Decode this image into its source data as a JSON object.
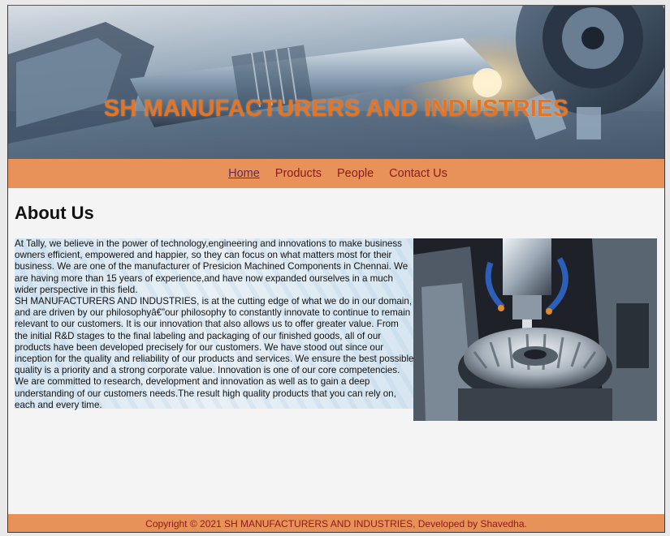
{
  "header": {
    "title": "SH MANUFACTURERS AND INDUSTRIES"
  },
  "nav": {
    "items": [
      {
        "label": "Home",
        "active": true
      },
      {
        "label": "Products",
        "active": false
      },
      {
        "label": "People",
        "active": false
      },
      {
        "label": "Contact Us",
        "active": false
      }
    ]
  },
  "about": {
    "heading": "About Us",
    "paragraph1": "At Tally, we believe in the power of technology,engineering and innovations to make business owners efficient, empowered and happier, so they can focus on what matters most for their business. We are one of the manufacturer of Presicion Machined Components in Chennai. We are having more than 15 years of experience,and have now expanded ourselves in a much wider perspective in this field.",
    "paragraph2": "SH MANUFACTURERS AND INDUSTRIES, is at the cutting edge of what we do in our domain, and are driven by our philosophyâ€”our philosophy to constantly innovate to continue to remain relevant to our customers. It is our innovation that also allows us to offer greater value. From the initial R&D stages to the final labeling and packaging of our finished goods, all of our products have been developed precisely for our customers. We have stood out since our inception for the quality and reliability of our products and services. We ensure the best possible quality is a priority and a strong corporate value. Innovation is one of our core competencies. We are committed to research, development and innovation as well as to gain a deep understanding of our customers needs.The result high quality products that you can rely on, each and every time."
  },
  "footer": {
    "text": "Copyright © 2021 SH MANUFACTURERS AND INDUSTRIES, Developed by Shavedha."
  },
  "colors": {
    "accent_orange": "#e9731e",
    "nav_background": "#e8925a",
    "nav_link": "#8b1a1a"
  }
}
